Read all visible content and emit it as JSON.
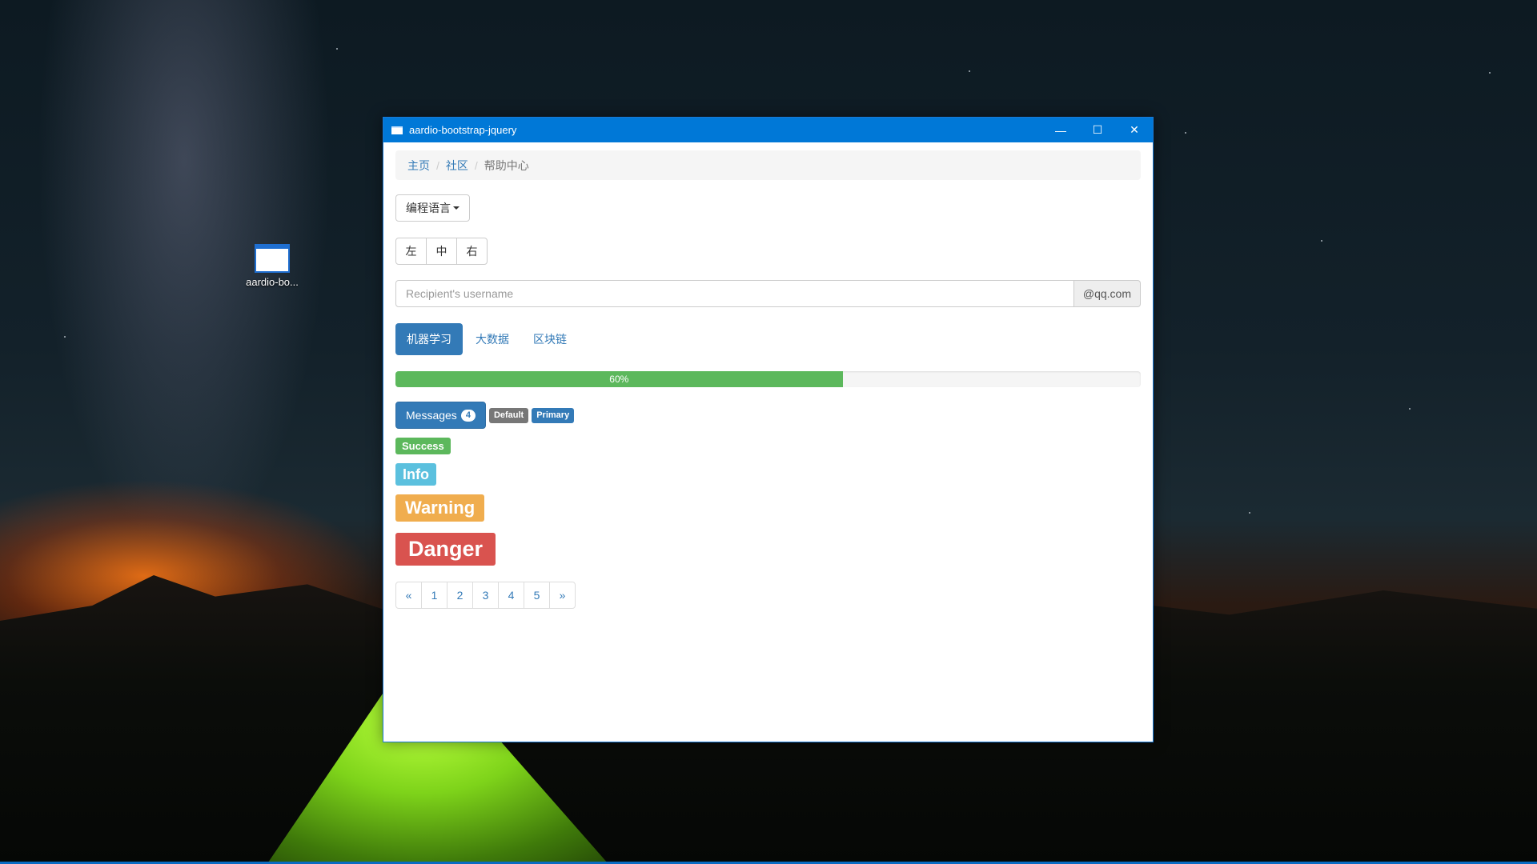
{
  "desktop": {
    "icon_label": "aardio-bo..."
  },
  "window": {
    "title": "aardio-bootstrap-jquery",
    "controls": {
      "minimize": "—",
      "maximize": "☐",
      "close": "✕"
    }
  },
  "breadcrumb": {
    "items": [
      "主页",
      "社区"
    ],
    "active": "帮助中心",
    "separator": "/"
  },
  "dropdown": {
    "label": "编程语言"
  },
  "button_group": [
    "左",
    "中",
    "右"
  ],
  "input": {
    "placeholder": "Recipient's username",
    "addon": "@qq.com"
  },
  "pills": [
    "机器学习",
    "大数据",
    "区块链"
  ],
  "progress": {
    "percent": 60,
    "label": "60%",
    "color": "#5cb85c"
  },
  "messages": {
    "label": "Messages",
    "badge": "4"
  },
  "labels": {
    "default": "Default",
    "primary": "Primary",
    "success": "Success",
    "info": "Info",
    "warning": "Warning",
    "danger": "Danger"
  },
  "pagination": [
    "«",
    "1",
    "2",
    "3",
    "4",
    "5",
    "»"
  ],
  "colors": {
    "titlebar": "#0078d7",
    "primary": "#337ab7",
    "success": "#5cb85c",
    "info": "#5bc0de",
    "warning": "#f0ad4e",
    "danger": "#d9534f"
  }
}
